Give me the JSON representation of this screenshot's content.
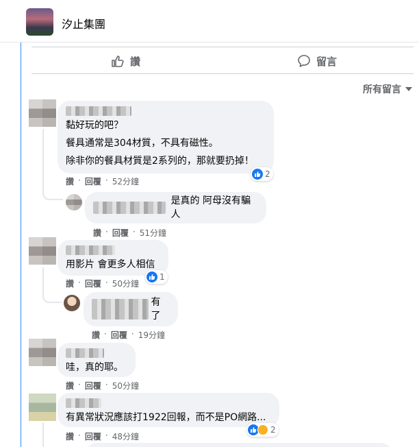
{
  "group": {
    "name": "汐止集團"
  },
  "actions": {
    "like": "讚",
    "comment": "留言"
  },
  "sort": {
    "label": "所有留言"
  },
  "comments": [
    {
      "lines": [
        "黏好玩的吧？",
        "餐具通常是304材質，不具有磁性。",
        "除非你的餐具材質是2系列的，那就要扔掉！"
      ],
      "like": "讚",
      "reply": "回覆",
      "time": "52分鐘",
      "reactions": "2"
    },
    {
      "text": "是真的 阿母沒有騙人",
      "like": "讚",
      "reply": "回覆",
      "time": "51分鐘"
    },
    {
      "text": "用影片 會更多人相信",
      "like": "讚",
      "reply": "回覆",
      "time": "50分鐘",
      "reactions": "1"
    },
    {
      "text": "有了",
      "like": "讚",
      "reply": "回覆",
      "time": "19分鐘"
    },
    {
      "text": "哇，真的耶。",
      "like": "讚",
      "reply": "回覆",
      "time": "50分鐘"
    },
    {
      "text": "有異常狀況應該打1922回報，而不是PO網路...",
      "like": "讚",
      "reply": "回覆",
      "time": "48分鐘",
      "reactions": "2"
    }
  ],
  "icons": {
    "like": "thumbs-up-icon",
    "comment": "speech-bubble-icon",
    "caret": "caret-down-icon"
  }
}
